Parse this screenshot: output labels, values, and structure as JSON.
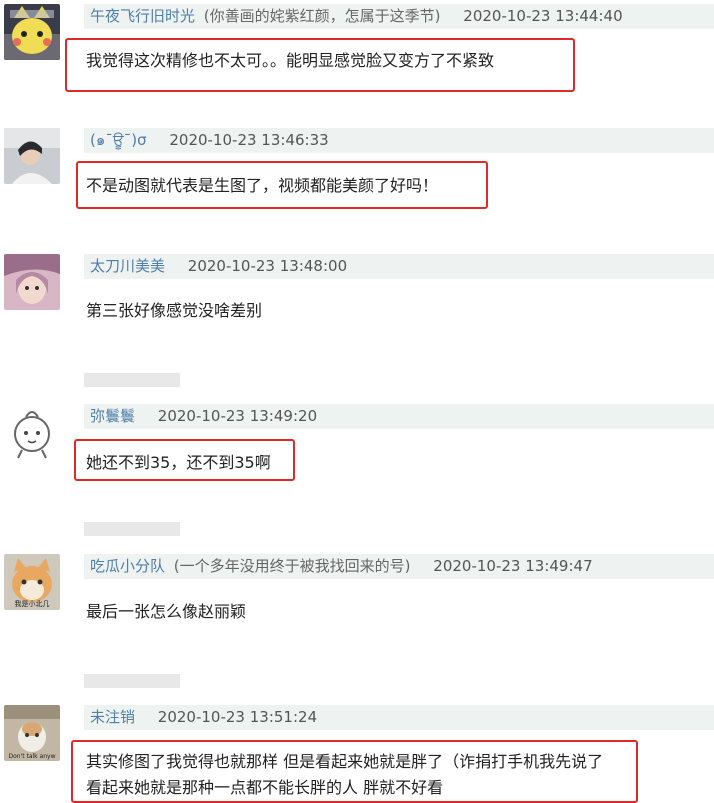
{
  "comments": [
    {
      "username": "午夜飞行旧时光",
      "note": "(你善画的姹紫红颜，怎属于这季节)",
      "timestamp": "2020-10-23 13:44:40",
      "text": "我觉得这次精修也不太可。。能明显感觉脸又变方了不紧致",
      "highlighted": true
    },
    {
      "username": "(๑¯ਊ¯)σ",
      "note": "",
      "timestamp": "2020-10-23 13:46:33",
      "text": "不是动图就代表是生图了，视频都能美颜了好吗！",
      "highlighted": true
    },
    {
      "username": "太刀川美美",
      "note": "",
      "timestamp": "2020-10-23 13:48:00",
      "text": "第三张好像感觉没啥差别",
      "highlighted": false
    },
    {
      "username": "弥鬟鬟",
      "note": "",
      "timestamp": "2020-10-23 13:49:20",
      "text": "她还不到35，还不到35啊",
      "highlighted": true
    },
    {
      "username": "吃瓜小分队",
      "note": "(一个多年没用终于被我找回来的号)",
      "timestamp": "2020-10-23 13:49:47",
      "text": "最后一张怎么像赵丽颖",
      "avatar_text": "我是小北几",
      "highlighted": false
    },
    {
      "username": "未注销",
      "note": "",
      "timestamp": "2020-10-23 13:51:24",
      "text_lines": [
        "其实修图了我觉得也就那样 但是看起来她就是胖了（诈捐打手机我先说了",
        "看起来她就是那种一点都不能长胖的人 胖就不好看"
      ],
      "avatar_text": "Don't talk anyw",
      "highlighted": true
    }
  ],
  "colors": {
    "meta_bar": "#eef2f0",
    "username": "#4f7fa8",
    "highlight_border": "#e02a2a"
  }
}
